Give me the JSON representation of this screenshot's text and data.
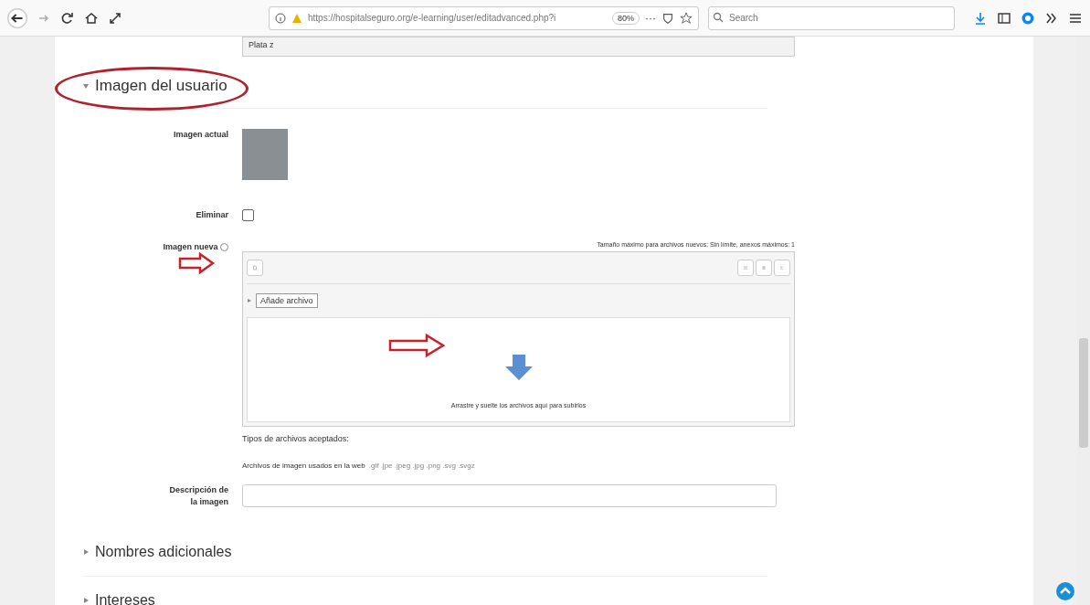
{
  "browser": {
    "url": "https://hospitalseguro.org/e-learning/user/editadvanced.php?i",
    "zoom": "80%",
    "more": "···",
    "search": {
      "placeholder": "Search"
    }
  },
  "textarea_value": "Plata z",
  "section": {
    "title": "Imagen del usuario",
    "expanded": true
  },
  "current_image": {
    "label": "Imagen actual"
  },
  "delete": {
    "label": "Eliminar",
    "checked": false
  },
  "new_image": {
    "label": "Imagen nueva",
    "max_size": "Tamaño máximo para archivos nuevos: Sin límite, anexos máximos: 1",
    "add_file": "Añade archivo",
    "drop_hint": "Arrastre y suelte los archivos aquí para subirlos"
  },
  "accepted_types": {
    "label": "Tipos de archivos aceptados:",
    "group": "Archivos de imagen usados en la web",
    "extensions": ".gif .jpe .jpeg .jpg .png .svg .svgz"
  },
  "description": {
    "label": "Descripción de la imagen"
  },
  "collapsed_sections": [
    {
      "title": "Nombres adicionales",
      "expanded": false
    },
    {
      "title": "Intereses",
      "expanded": false
    }
  ]
}
